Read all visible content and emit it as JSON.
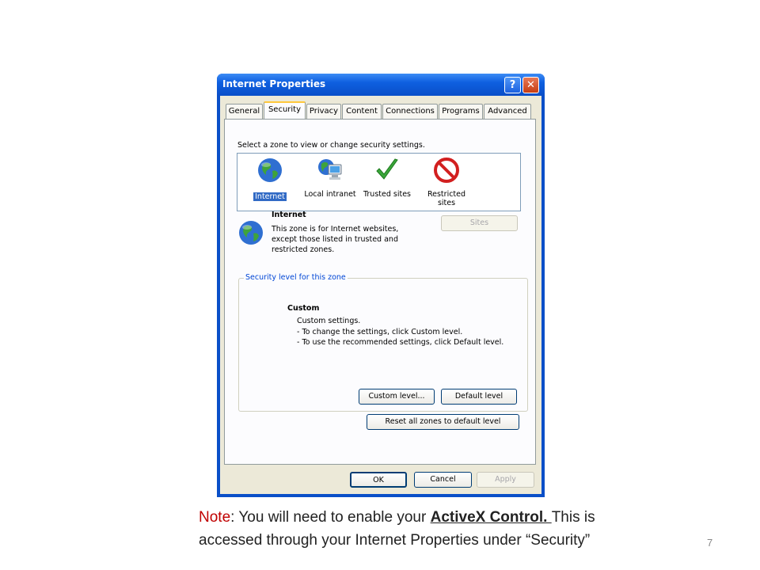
{
  "window": {
    "title": "Internet Properties",
    "help_label": "?",
    "close_label": "✕"
  },
  "tabs": [
    {
      "label": "General"
    },
    {
      "label": "Security"
    },
    {
      "label": "Privacy"
    },
    {
      "label": "Content"
    },
    {
      "label": "Connections"
    },
    {
      "label": "Programs"
    },
    {
      "label": "Advanced"
    }
  ],
  "security": {
    "zone_prompt": "Select a zone to view or change security settings.",
    "zones": [
      {
        "label": "Internet",
        "icon": "globe-icon"
      },
      {
        "label": "Local intranet",
        "icon": "intranet-icon"
      },
      {
        "label": "Trusted sites",
        "icon": "checkmark-icon"
      },
      {
        "label": "Restricted sites",
        "icon": "restricted-icon"
      }
    ],
    "zone_title": "Internet",
    "zone_desc": [
      "This zone is for Internet websites,",
      "except those listed in trusted and",
      "restricted zones."
    ],
    "sites_button": "Sites",
    "group_label": "Security level for this zone",
    "level_title": "Custom",
    "level_lines": [
      "Custom settings.",
      "- To change the settings, click Custom level.",
      "- To use the recommended settings, click Default level."
    ],
    "custom_level_button": "Custom level...",
    "default_level_button": "Default level",
    "reset_button": "Reset all zones to default level"
  },
  "footer": {
    "ok": "OK",
    "cancel": "Cancel",
    "apply": "Apply"
  },
  "caption": {
    "note_label": "Note",
    "line1_a": ":  You will need to enable your ",
    "line1_b": "ActiveX Control. ",
    "line1_c": " This is",
    "line2": "accessed through your Internet Properties under “Security”"
  },
  "page_number": "7",
  "colors": {
    "titlebar": "#0a4fc8",
    "selection": "#316ac5",
    "note_red": "#c00000"
  }
}
